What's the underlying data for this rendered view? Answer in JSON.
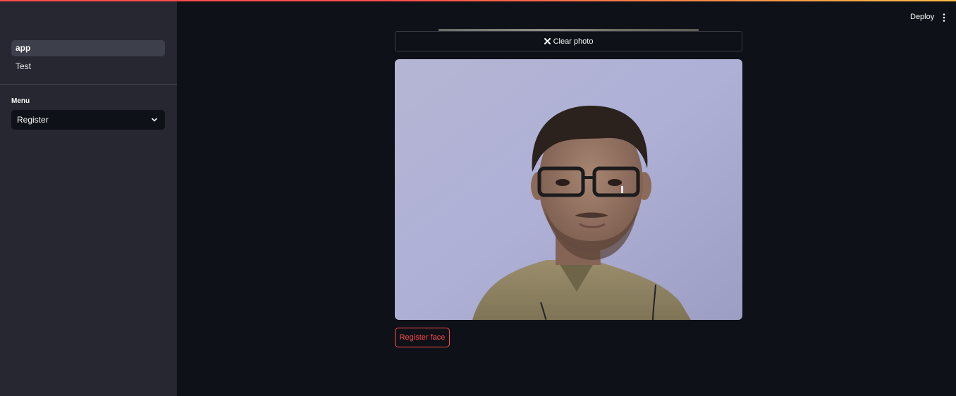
{
  "sidebar": {
    "nav": [
      {
        "label": "app",
        "active": true
      },
      {
        "label": "Test",
        "active": false
      }
    ],
    "menu_label": "Menu",
    "menu_selected": "Register"
  },
  "header": {
    "deploy_label": "Deploy"
  },
  "camera": {
    "clear_label": "Clear photo"
  },
  "actions": {
    "register_label": "Register face"
  },
  "colors": {
    "accent": "#ff4b4b",
    "background": "#0e1117",
    "sidebar": "#262730"
  }
}
